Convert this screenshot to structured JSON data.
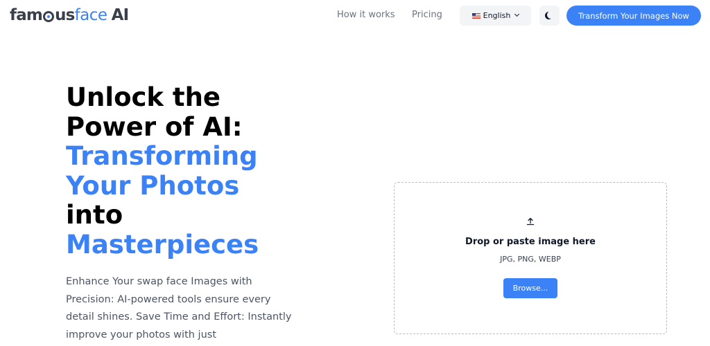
{
  "brand": {
    "name_part1": "fam",
    "name_part2": "us",
    "name_part3": "face",
    "name_part4": "AI"
  },
  "nav": {
    "how_it_works": "How it works",
    "pricing": "Pricing",
    "language": "English",
    "cta": "Transform Your Images Now"
  },
  "hero": {
    "title_line1": "Unlock the",
    "title_line2": "Power of AI:",
    "title_line3": "Transforming",
    "title_line4": "Your Photos",
    "title_line5": "into",
    "title_line6": "Masterpieces",
    "description": "Enhance Your swap face Images with Precision: AI-powered tools ensure every detail shines. Save Time and Effort: Instantly improve your photos with just"
  },
  "upload": {
    "title": "Drop or paste image here",
    "formats": "JPG, PNG, WEBP",
    "browse": "Browse..."
  },
  "colors": {
    "accent": "#3b82f6",
    "logo_dark": "#3a3f4a"
  },
  "icons": {
    "flag": "us-flag-icon",
    "chevron": "chevron-down-icon",
    "theme": "moon-icon",
    "upload": "upload-arrow-icon"
  }
}
